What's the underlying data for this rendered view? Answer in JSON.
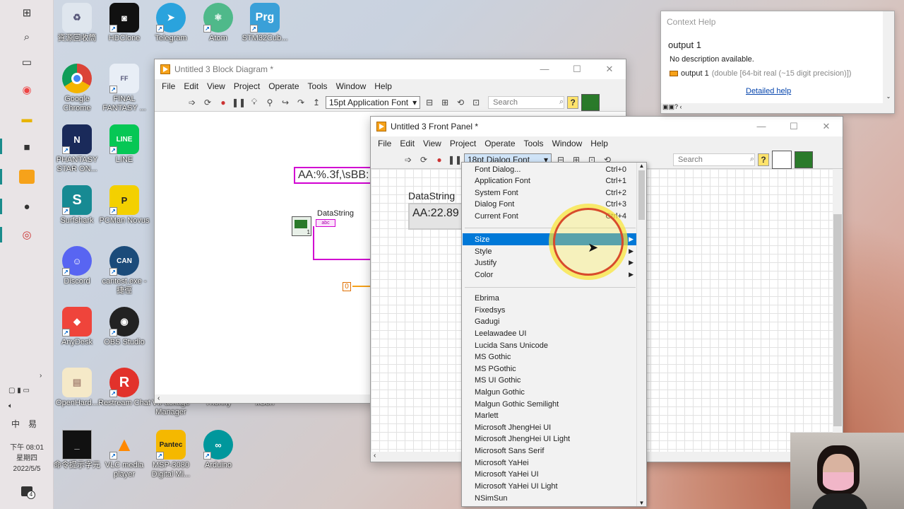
{
  "taskbar": {
    "clock_time": "下午 08:01",
    "clock_day": "星期四",
    "clock_date": "2022/5/5",
    "ime_label": "中",
    "ime_label2": "易",
    "notification_count": "4"
  },
  "desktop": {
    "icons": [
      {
        "label": "資源回收筒"
      },
      {
        "label": "HDClone"
      },
      {
        "label": "Telegram"
      },
      {
        "label": "Atom"
      },
      {
        "label": "STM32Cub..."
      },
      {
        "label": "Google Chrome"
      },
      {
        "label": "FINAL FANTASY ..."
      },
      {
        "label": "PHANTASY STAR ON..."
      },
      {
        "label": "LINE"
      },
      {
        "label": "Surfshark"
      },
      {
        "label": "PCMan Novus"
      },
      {
        "label": "Discord"
      },
      {
        "label": "cantest.exe - 捷徑"
      },
      {
        "label": "AnyDesk"
      },
      {
        "label": "OBS Studio"
      },
      {
        "label": "OpenHard..."
      },
      {
        "label": "Restream Chat"
      },
      {
        "label": "VIPackage Manager"
      },
      {
        "label": "Thonny"
      },
      {
        "label": "xGen"
      },
      {
        "label": "命令提示字元"
      },
      {
        "label": "VLC media player"
      },
      {
        "label": "MSP-3080 Digital Mi..."
      },
      {
        "label": "Arduino"
      }
    ]
  },
  "block_diagram": {
    "title": "Untitled 3 Block Diagram *",
    "menu": [
      "File",
      "Edit",
      "View",
      "Project",
      "Operate",
      "Tools",
      "Window",
      "Help"
    ],
    "font_select": "15pt Application Font",
    "search_placeholder": "Search",
    "format_string": "AA:%.3f,\\sBB:",
    "indicator_label": "DataString",
    "indicator_tag": "abc",
    "const_value": "0",
    "index_value": "1"
  },
  "front_panel": {
    "title": "Untitled 3 Front Panel *",
    "menu": [
      "File",
      "Edit",
      "View",
      "Project",
      "Operate",
      "Tools",
      "Window",
      "Help"
    ],
    "font_select": "18pt Dialog Font",
    "search_placeholder": "Search",
    "datastring_label": "DataString",
    "datastring_value": "AA:22.89"
  },
  "font_menu": {
    "top_items": [
      {
        "label": "Font Dialog...",
        "shortcut": "Ctrl+0"
      },
      {
        "label": "Application Font",
        "shortcut": "Ctrl+1"
      },
      {
        "label": "System Font",
        "shortcut": "Ctrl+2"
      },
      {
        "label": "Dialog Font",
        "shortcut": "Ctrl+3"
      },
      {
        "label": "Current Font",
        "shortcut": "Ctrl+4"
      }
    ],
    "sub_items": [
      {
        "label": "Size"
      },
      {
        "label": "Style"
      },
      {
        "label": "Justify"
      },
      {
        "label": "Color"
      }
    ],
    "selected": "Size",
    "fonts": [
      "Ebrima",
      "Fixedsys",
      "Gadugi",
      "Leelawadee UI",
      "Lucida Sans Unicode",
      "MS Gothic",
      "MS PGothic",
      "MS UI Gothic",
      "Malgun Gothic",
      "Malgun Gothic Semilight",
      "Marlett",
      "Microsoft JhengHei UI",
      "Microsoft JhengHei UI Light",
      "Microsoft Sans Serif",
      "Microsoft YaHei",
      "Microsoft YaHei UI",
      "Microsoft YaHei UI Light",
      "NSimSun"
    ]
  },
  "context_help": {
    "title": "Context Help",
    "heading": "output 1",
    "description": "No description available.",
    "terminal": "output 1",
    "terminal_type": "(double [64-bit real (~15 digit precision)])",
    "link": "Detailed help"
  },
  "colors": {
    "accent": "#0078d7",
    "labview_orange": "#f6a21a",
    "string_pink": "#d100d1"
  }
}
